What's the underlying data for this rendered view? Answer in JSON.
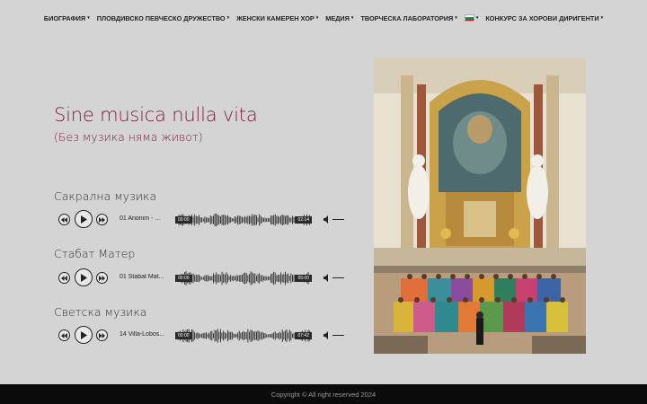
{
  "nav": {
    "items": [
      {
        "label": "БИОГРАФИЯ",
        "caret": "▾"
      },
      {
        "label": "ПЛОВДИВСКО ПЕВЧЕСКО ДРУЖЕСТВО",
        "caret": "▾"
      },
      {
        "label": "ЖЕНСКИ КАМЕРЕН ХОР",
        "caret": "▾"
      },
      {
        "label": "МЕДИЯ",
        "caret": "▾"
      },
      {
        "label": "ТВОРЧЕСКА ЛАБОРАТОРИЯ",
        "caret": "▾"
      },
      {
        "label": "",
        "caret": "▾",
        "flag": "bg-flag-icon"
      },
      {
        "label": "КОНКУРС ЗА ХОРОВИ ДИРИГЕНТИ",
        "caret": "▾"
      }
    ]
  },
  "hero": {
    "title": "Sine musica nulla vita",
    "subtitle": "(Без музика няма живот)"
  },
  "sections": [
    {
      "title": "Сакрална музика",
      "track": "01 Anonim - ...",
      "current_time": "00:00",
      "duration": "02:14"
    },
    {
      "title": "Стабат Матер",
      "track": "01 Stabat Mat...",
      "current_time": "00:00",
      "duration": "05:00"
    },
    {
      "title": "Светска музика",
      "track": "14 Villa-Lobos...",
      "current_time": "00:00",
      "duration": "07:42"
    }
  ],
  "colors": {
    "background": "#d4d4d4",
    "accent": "#7a2440",
    "footer_bg": "#0b0b0b"
  },
  "footer": {
    "copyright": "Copyright © All right reserved 2024"
  }
}
